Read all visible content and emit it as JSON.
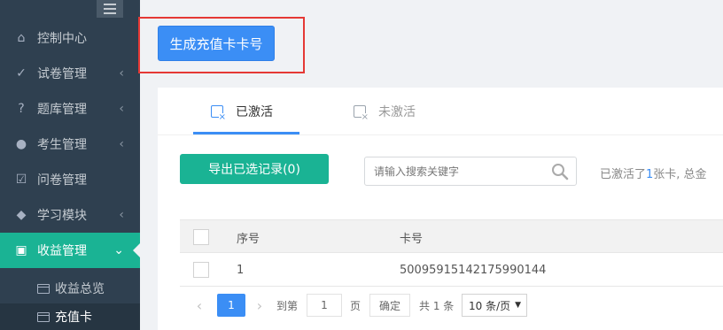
{
  "sidebar": {
    "items": [
      {
        "label": "控制中心",
        "icon": "home-icon",
        "glyph": "⌂",
        "has_chevron": false
      },
      {
        "label": "试卷管理",
        "icon": "check-circle-icon",
        "glyph": "✓",
        "has_chevron": true
      },
      {
        "label": "题库管理",
        "icon": "question-circle-icon",
        "glyph": "?",
        "has_chevron": true
      },
      {
        "label": "考生管理",
        "icon": "user-icon",
        "glyph": "●",
        "has_chevron": true
      },
      {
        "label": "问卷管理",
        "icon": "checkbox-icon",
        "glyph": "☑",
        "has_chevron": false
      },
      {
        "label": "学习模块",
        "icon": "graduation-cap-icon",
        "glyph": "◆",
        "has_chevron": true
      },
      {
        "label": "收益管理",
        "icon": "money-icon",
        "glyph": "▣",
        "has_chevron": true,
        "active": true
      }
    ],
    "subitems": [
      {
        "label": "收益总览",
        "icon": "credit-card-icon"
      },
      {
        "label": "充值卡",
        "icon": "credit-card-icon",
        "current": true
      }
    ]
  },
  "toolbar": {
    "generate_label": "生成充值卡卡号"
  },
  "tabs": [
    {
      "label": "已激活",
      "icon": "activated-card-icon",
      "active": true
    },
    {
      "label": "未激活",
      "icon": "inactive-card-icon",
      "active": false
    }
  ],
  "actions": {
    "export_label": "导出已选记录(0)"
  },
  "search": {
    "placeholder": "请输入搜索关键字",
    "value": ""
  },
  "summary": {
    "prefix": "已激活了",
    "count": "1",
    "suffix": "张卡, 总金"
  },
  "table": {
    "columns": [
      "序号",
      "卡号"
    ],
    "rows": [
      {
        "index": "1",
        "card_no": "5009591514217599014​4"
      }
    ]
  },
  "pagination": {
    "prev": "‹",
    "current_page": "1",
    "next": "›",
    "goto_label": "到第",
    "goto_value": "1",
    "page_unit": "页",
    "confirm_label": "确定",
    "total_label": "共 1 条",
    "page_size": "10 条/页"
  },
  "colors": {
    "sidebar_bg": "#2f4050",
    "accent_green": "#1ab394",
    "primary_blue": "#3b8ef5",
    "highlight_red": "#e53935"
  }
}
